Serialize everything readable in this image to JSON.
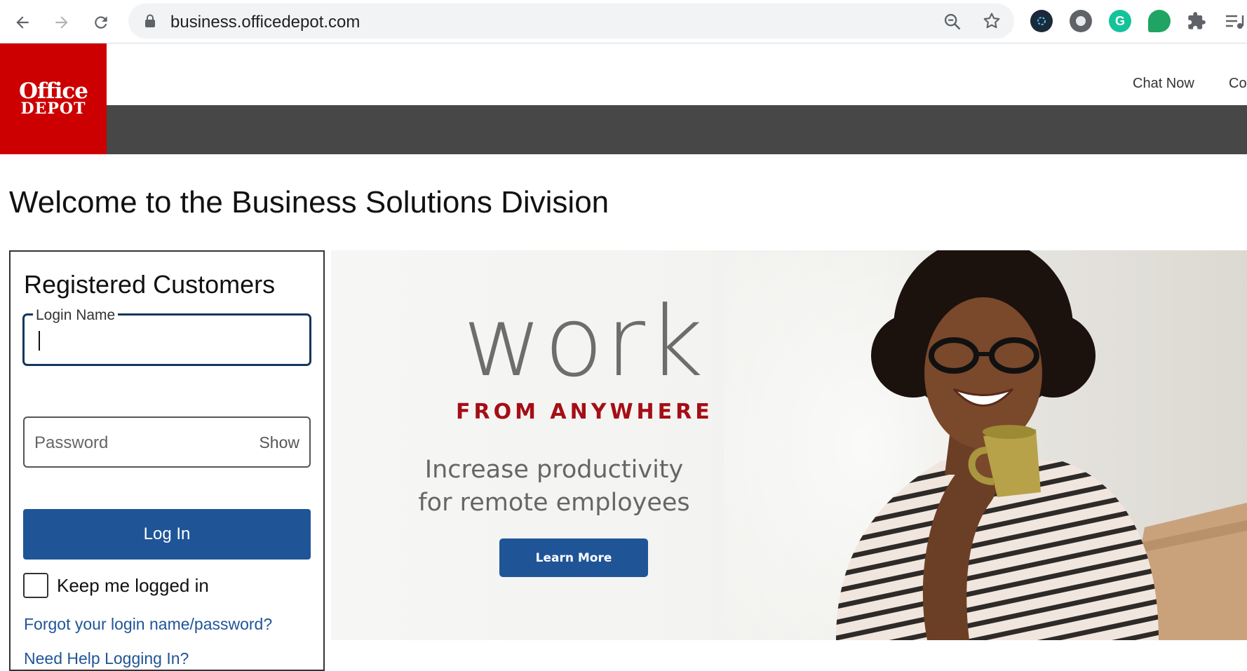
{
  "browser": {
    "url": "business.officedepot.com"
  },
  "header": {
    "logo_line1": "Office",
    "logo_line2": "DEPOT",
    "chat_now": "Chat Now",
    "contact": "Co"
  },
  "page": {
    "title": "Welcome to the Business Solutions Division"
  },
  "login": {
    "heading": "Registered Customers",
    "login_name_label": "Login Name",
    "login_name_value": "",
    "password_placeholder": "Password",
    "show_label": "Show",
    "login_button": "Log In",
    "keep_logged_in": "Keep me logged in",
    "keep_logged_in_checked": false,
    "forgot_link": "Forgot your login name/password?",
    "help_link": "Need Help Logging In?"
  },
  "hero": {
    "headline": "work",
    "tagline": "FROM ANYWHERE",
    "subtext": "Increase productivity for remote employees",
    "button": "Learn More"
  },
  "colors": {
    "brand_red": "#cc0000",
    "primary_blue": "#1f5597",
    "header_bar": "#474747",
    "tagline_red": "#a50e16"
  }
}
